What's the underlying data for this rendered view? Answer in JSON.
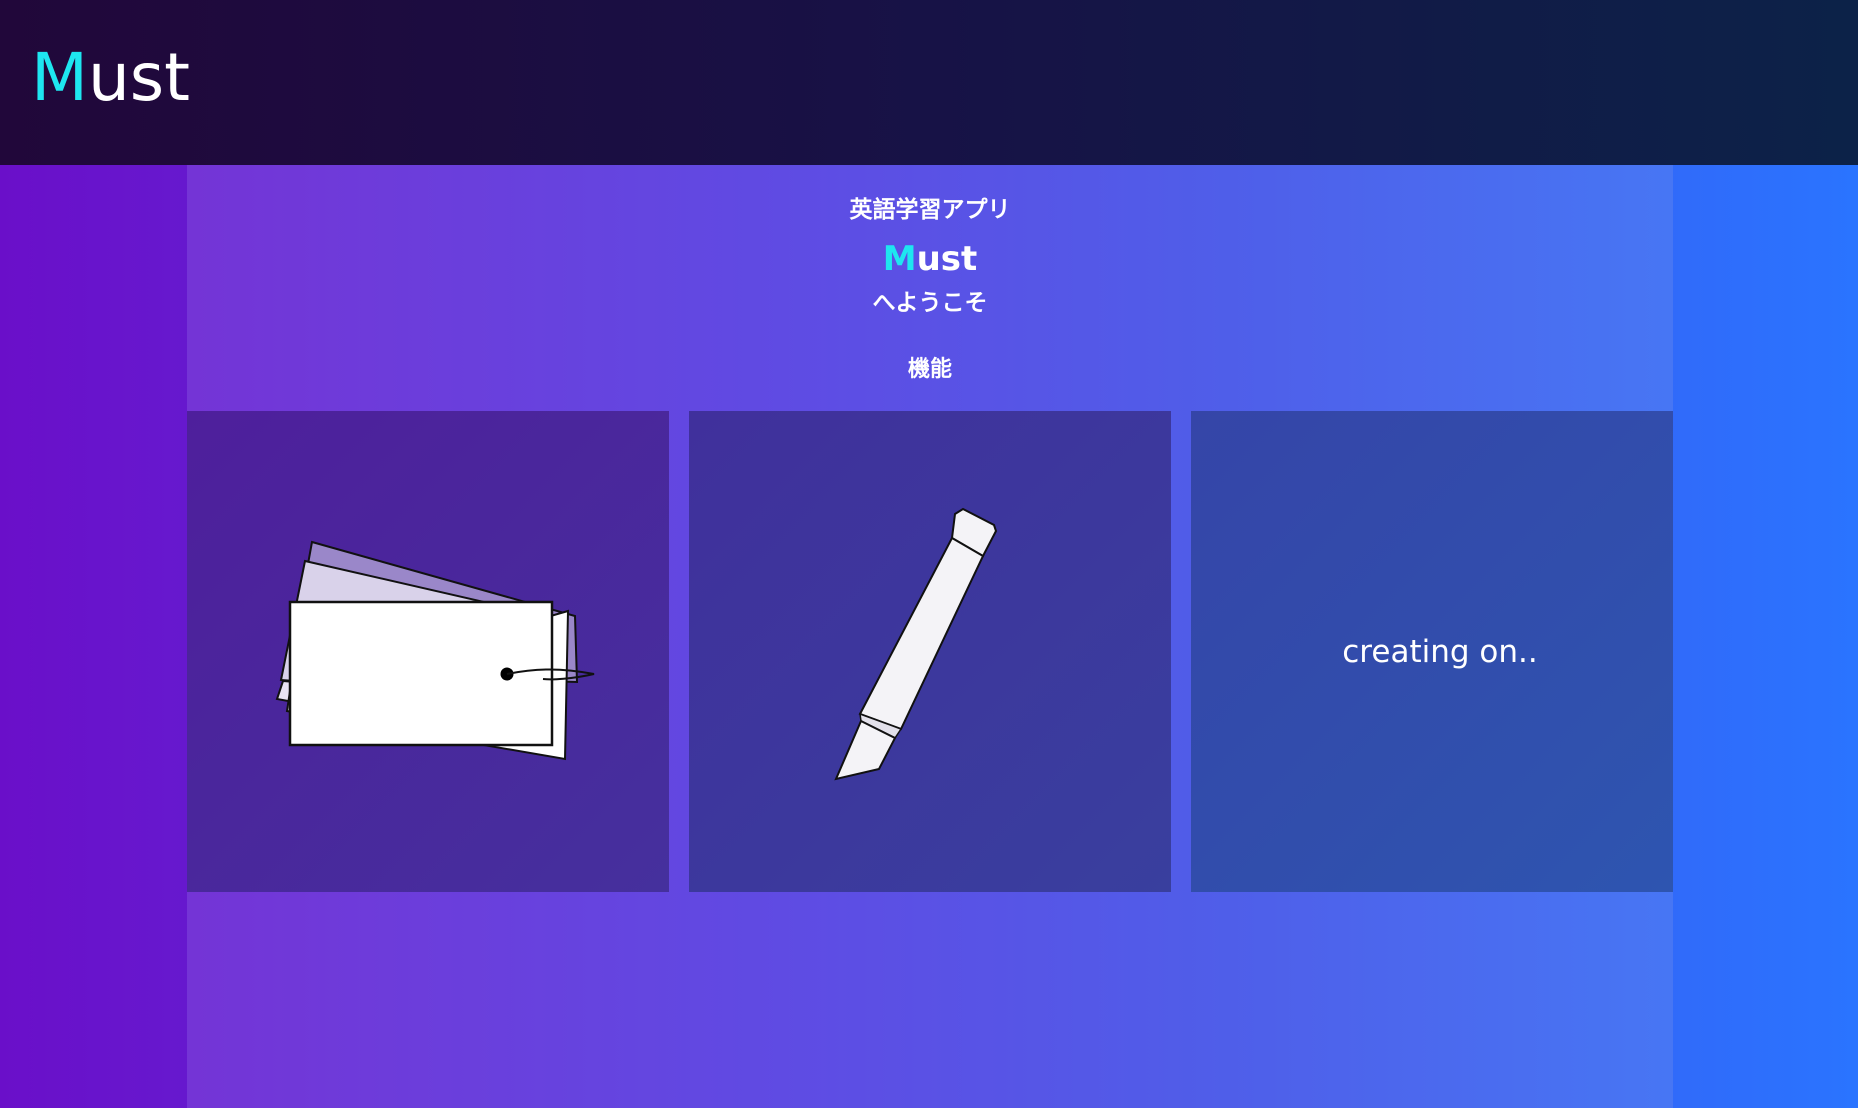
{
  "header": {
    "logo_accent": "M",
    "logo_rest": "ust"
  },
  "hero": {
    "subtitle": "英語学習アプリ",
    "brand_accent": "M",
    "brand_rest": "ust",
    "welcome": "へようこそ",
    "features_heading": "機能"
  },
  "cards": [
    {
      "icon": "flashcards-icon"
    },
    {
      "icon": "pen-icon"
    },
    {
      "label": "creating on.."
    }
  ],
  "colors": {
    "accent": "#1ee6f0",
    "header_bg_start": "#21073a",
    "header_bg_end": "#0c2248",
    "page_bg_start": "#6a0fc9",
    "page_bg_end": "#2a74ff"
  }
}
